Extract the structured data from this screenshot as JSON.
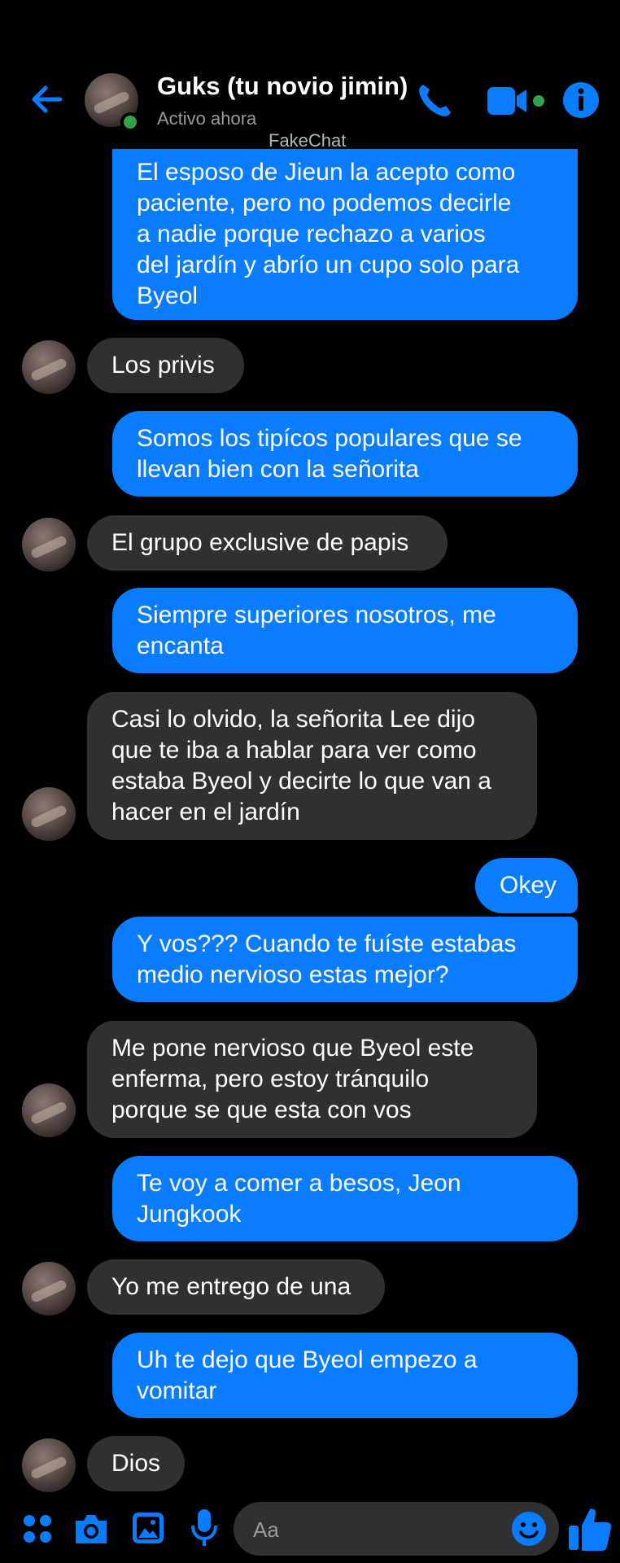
{
  "header": {
    "contact_name": "Guks (tu novio jimin)",
    "status": "Activo ahora",
    "watermark": "FakeChat",
    "icons": [
      "back-arrow-icon",
      "phone-icon",
      "video-camera-icon",
      "info-icon"
    ]
  },
  "messages": [
    {
      "side": "out",
      "text": "El esposo de Jieun la acepto como\npaciente, pero no podemos decirle\na nadie porque rechazo a varios\ndel jardín y abrío un cupo solo para\nByeol"
    },
    {
      "side": "in",
      "text": "Los privis"
    },
    {
      "side": "out",
      "text": "Somos los tipícos populares que se\nllevan bien con la señorita"
    },
    {
      "side": "in",
      "text": "El grupo exclusive de papis"
    },
    {
      "side": "out",
      "text": "Siempre superiores nosotros, me\nencanta"
    },
    {
      "side": "in",
      "text": "Casi lo olvido, la señorita Lee dijo\nque te iba a hablar para ver como\nestaba Byeol y decirte lo que van a\nhacer en el jardín"
    },
    {
      "side": "out",
      "text": "Okey"
    },
    {
      "side": "out",
      "text": "Y vos??? Cuando te fuíste estabas\nmedio nervioso estas mejor?"
    },
    {
      "side": "in",
      "text": "Me pone nervioso que Byeol este\nenferma, pero estoy tránquilo\nporque se que esta con vos"
    },
    {
      "side": "out",
      "text": "Te voy a comer a besos, Jeon\nJungkook"
    },
    {
      "side": "in",
      "text": "Yo me entrego de una"
    },
    {
      "side": "out",
      "text": "Uh te dejo que Byeol empezo a\nvomitar"
    },
    {
      "side": "in",
      "text": "Dios"
    }
  ],
  "composer": {
    "placeholder": "Aa",
    "icons": [
      "apps-icon",
      "camera-icon",
      "gallery-icon",
      "microphone-icon",
      "emoji-icon",
      "thumbs-up-icon"
    ]
  },
  "colors": {
    "accent": "#0a7cff",
    "incoming_bubble": "#303030",
    "online": "#31a24c",
    "background": "#000000"
  }
}
